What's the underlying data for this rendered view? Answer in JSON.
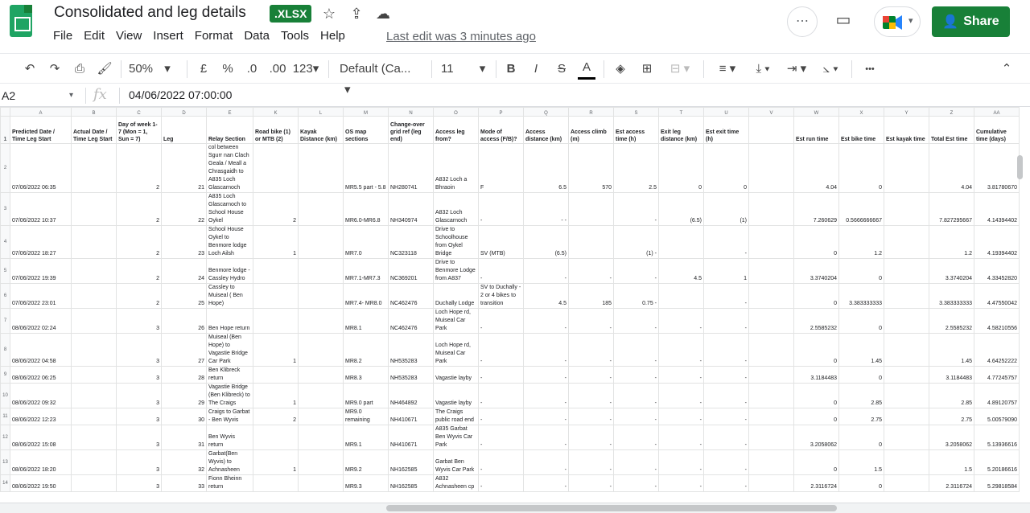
{
  "app": {
    "doc_title": "Consolidated and leg details",
    "badge": ".XLSX",
    "share_label": "Share",
    "last_edit": "Last edit was 3 minutes ago"
  },
  "menu": [
    "File",
    "Edit",
    "View",
    "Insert",
    "Format",
    "Data",
    "Tools",
    "Help"
  ],
  "toolbar": {
    "zoom": "50%",
    "currency": "£",
    "percent": "%",
    "decrease_decimal": ".0",
    "increase_decimal": ".00",
    "number_format": "123",
    "font": "Default (Ca...",
    "font_size": "11",
    "bold": "B",
    "italic": "I",
    "strike": "S",
    "text_color": "A",
    "more": "•••"
  },
  "formula": {
    "cell_ref": "A2",
    "fx": "fx",
    "value": "04/06/2022 07:00:00"
  },
  "columns": [
    "A",
    "B",
    "C",
    "D",
    "E",
    "K",
    "L",
    "M",
    "N",
    "O",
    "P",
    "Q",
    "R",
    "S",
    "T",
    "U",
    "V",
    "W",
    "X",
    "Y",
    "Z",
    "AA"
  ],
  "header_row": [
    "Predicted Date / Time Leg Start",
    "Actual Date / Time Leg Start",
    "Day of week 1-7 (Mon = 1, Sun = 7)",
    "Leg",
    "Relay Section",
    "Road bike (1) or MTB (2)",
    "Kayak Distance (km)",
    "OS map sections",
    "Change-over grid ref (leg end)",
    "Access leg from?",
    "Mode of access (F/B)?",
    "Access distance (km)",
    "Access climb (m)",
    "Est access time (h)",
    "Exit leg distance (km)",
    "Est exit time (h)",
    "",
    "Est run time",
    "Est bike time",
    "Est kayak time",
    "Total Est time",
    "Cumulative time (days)"
  ],
  "rows": [
    {
      "n": "2",
      "cells": [
        "07/06/2022 06:35",
        "",
        "2",
        "21",
        "col between Sgurr nan Clach Geala / Meall a Chrasgaidh to A835 Loch Glascarnoch",
        "",
        "",
        "MR5.5 part - 5.8",
        "NH280741",
        "A832 Loch a Bhraoin",
        "F",
        "6.5",
        "570",
        "2.5",
        "0",
        "0",
        "",
        "4.04",
        "0",
        "",
        "4.04",
        "3.81780670"
      ]
    },
    {
      "n": "3",
      "cells": [
        "07/06/2022 10:37",
        "",
        "2",
        "22",
        "A835 Loch Glascarnoch to School House Oykel",
        "2",
        "",
        "MR6.0-MR6.8",
        "NH340974",
        "A832 Loch Glascarnoch",
        "-",
        "- -",
        "",
        "-",
        "(6.5)",
        "(1)",
        "",
        "7.260629",
        "0.5666666667",
        "",
        "7.827295667",
        "4.14394402"
      ]
    },
    {
      "n": "4",
      "cells": [
        "07/06/2022 18:27",
        "",
        "2",
        "23",
        "School House Oykel to Benmore lodge Loch Ailsh",
        "1",
        "",
        "MR7.0",
        "NC323118",
        "Drive to Schoolhouse from Oykel Bridge",
        "SV (MTB)",
        "(6.5)",
        "",
        "(1) -",
        "",
        "-",
        "",
        "0",
        "1.2",
        "",
        "1.2",
        "4.19394402"
      ]
    },
    {
      "n": "5",
      "cells": [
        "07/06/2022 19:39",
        "",
        "2",
        "24",
        "Benmore lodge - Cassley Hydro",
        "",
        "",
        "MR7.1-MR7.3",
        "NC369201",
        "Drive to Benmore Lodge from A837",
        "-",
        "-",
        "-",
        "-",
        "4.5",
        "1",
        "",
        "3.3740204",
        "0",
        "",
        "3.3740204",
        "4.33452820"
      ]
    },
    {
      "n": "6",
      "cells": [
        "07/06/2022 23:01",
        "",
        "2",
        "25",
        "Cassley to Muiseal ( Ben Hope)",
        "",
        "",
        "MR7.4- MR8.0",
        "NC462476",
        "Duchally Lodge",
        "SV to Duchally - 2 or 4 bikes to transition",
        "4.5",
        "185",
        "0.75 -",
        "",
        "-",
        "",
        "0",
        "3.383333333",
        "",
        "3.383333333",
        "4.47550042"
      ]
    },
    {
      "n": "7",
      "cells": [
        "08/06/2022 02:24",
        "",
        "3",
        "26",
        "Ben Hope return",
        "",
        "",
        "MR8.1",
        "NC462476",
        "Loch Hope rd, Muiseal Car Park",
        "-",
        "-",
        "-",
        "-",
        "-",
        "-",
        "",
        "2.5585232",
        "0",
        "",
        "2.5585232",
        "4.58210556"
      ]
    },
    {
      "n": "8",
      "cells": [
        "08/06/2022 04:58",
        "",
        "3",
        "27",
        "Muiseal (Ben Hope) to Vagastie Bridge Car Park",
        "1",
        "",
        "MR8.2",
        "NH535283",
        "Loch Hope rd, Muiseal Car Park",
        "-",
        "-",
        "-",
        "-",
        "-",
        "-",
        "",
        "0",
        "1.45",
        "",
        "1.45",
        "4.64252222"
      ]
    },
    {
      "n": "9",
      "cells": [
        "08/06/2022 06:25",
        "",
        "3",
        "28",
        "Ben Klibreck return",
        "",
        "",
        "MR8.3",
        "NH535283",
        "Vagastie layby",
        "-",
        "-",
        "-",
        "-",
        "-",
        "-",
        "",
        "3.1184483",
        "0",
        "",
        "3.1184483",
        "4.77245757"
      ]
    },
    {
      "n": "10",
      "cells": [
        "08/06/2022 09:32",
        "",
        "3",
        "29",
        "Vagastie Bridge (Ben Klibreck) to The Craigs",
        "1",
        "",
        "MR9.0 part",
        "NH464892",
        "Vagastie layby",
        "-",
        "-",
        "-",
        "-",
        "-",
        "-",
        "",
        "0",
        "2.85",
        "",
        "2.85",
        "4.89120757"
      ]
    },
    {
      "n": "11",
      "cells": [
        "08/06/2022 12:23",
        "",
        "3",
        "30",
        "Craigs to Garbat - Ben Wyvis",
        "2",
        "",
        "MR9.0 remaining",
        "NH410671",
        "The Craigs public road end",
        "-",
        "-",
        "-",
        "-",
        "-",
        "-",
        "",
        "0",
        "2.75",
        "",
        "2.75",
        "5.00579090"
      ]
    },
    {
      "n": "12",
      "cells": [
        "08/06/2022 15:08",
        "",
        "3",
        "31",
        "Ben Wyvis return",
        "",
        "",
        "MR9.1",
        "NH410671",
        "A835 Garbat Ben Wyvis Car Park",
        "-",
        "-",
        "-",
        "-",
        "-",
        "-",
        "",
        "3.2058062",
        "0",
        "",
        "3.2058062",
        "5.13936616"
      ]
    },
    {
      "n": "13",
      "cells": [
        "08/06/2022 18:20",
        "",
        "3",
        "32",
        "Garbat(Ben Wyvis) to Achnasheen",
        "1",
        "",
        "MR9.2",
        "NH162585",
        "Garbat Ben Wyvis Car Park",
        "-",
        "-",
        "-",
        "-",
        "-",
        "-",
        "",
        "0",
        "1.5",
        "",
        "1.5",
        "5.20186616"
      ]
    },
    {
      "n": "14",
      "cells": [
        "08/06/2022 19:50",
        "",
        "3",
        "33",
        "Fionn Bheinn return",
        "",
        "",
        "MR9.3",
        "NH162585",
        "A832 Achnasheen cp",
        "-",
        "-",
        "-",
        "-",
        "-",
        "-",
        "",
        "2.3116724",
        "0",
        "",
        "2.3116724",
        "5.29818584"
      ]
    }
  ],
  "colors": {
    "accent": "#188038",
    "logo": "#1fa463"
  }
}
